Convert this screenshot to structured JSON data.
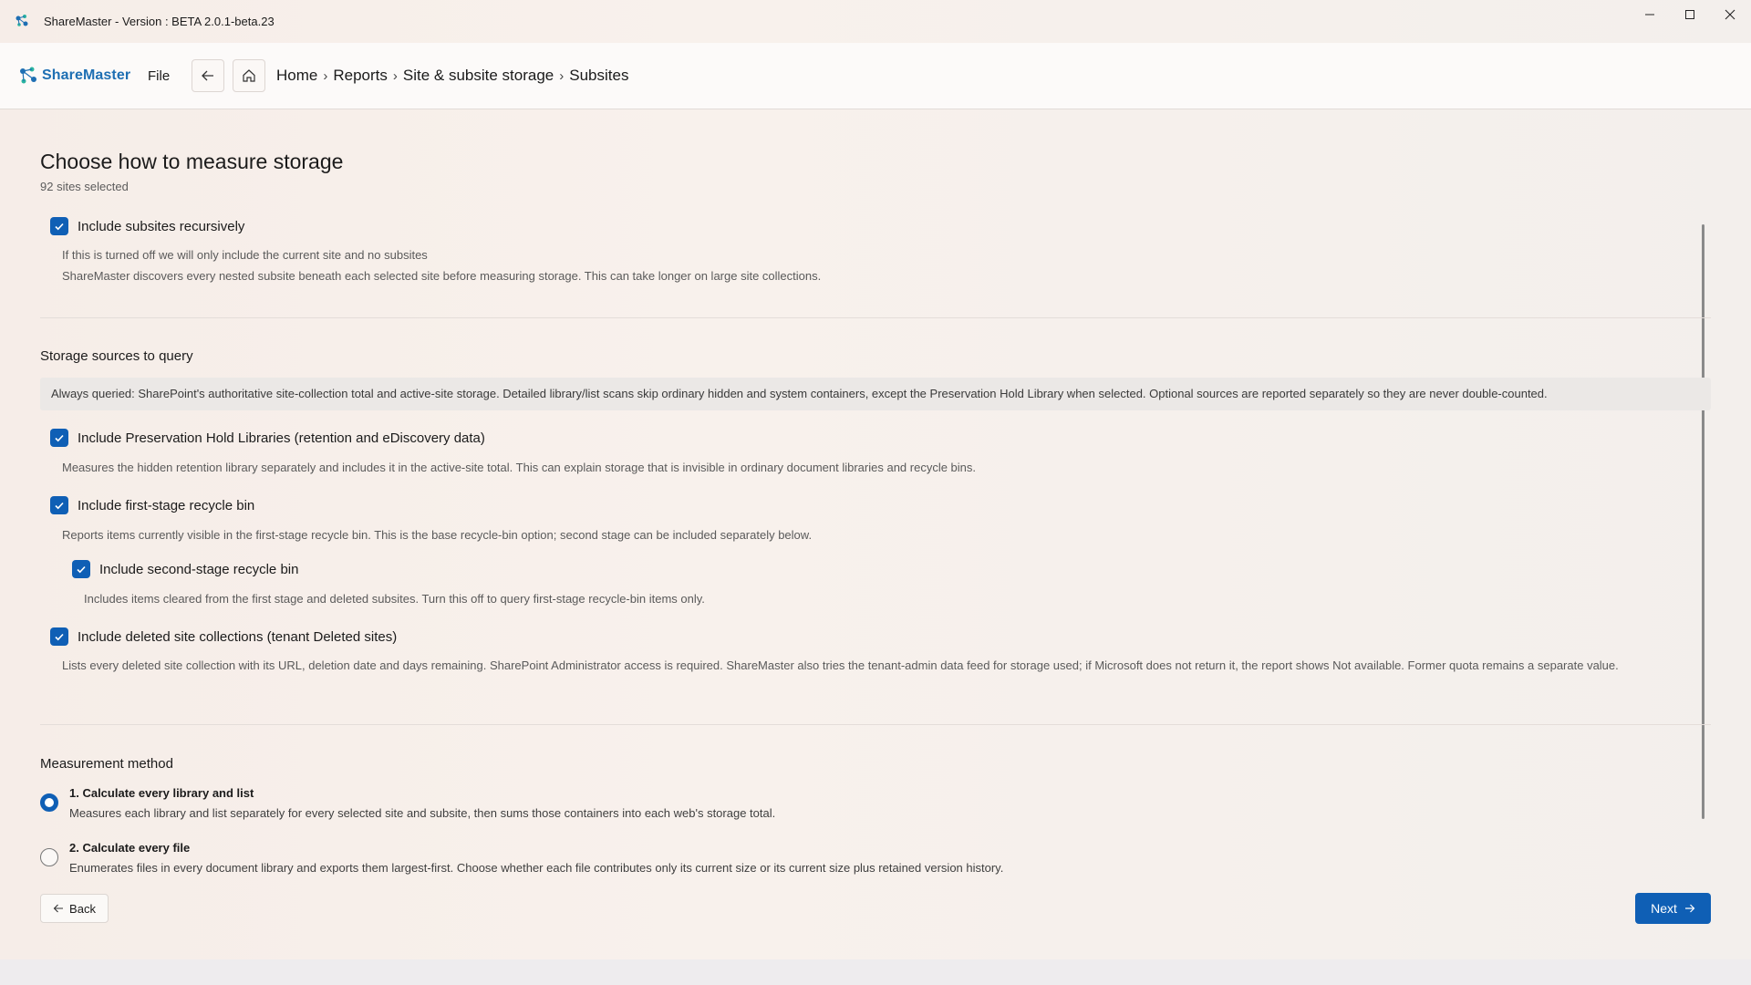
{
  "window": {
    "title": "ShareMaster - Version : BETA 2.0.1-beta.23"
  },
  "header": {
    "logo_text": "ShareMaster",
    "file_label": "File",
    "breadcrumb": [
      "Home",
      "Reports",
      "Site & subsite storage",
      "Subsites"
    ],
    "separator": "›"
  },
  "main": {
    "title": "Choose how to measure storage",
    "subtitle": "92 sites selected",
    "recursive": {
      "label": "Include subsites recursively",
      "checked": true,
      "desc_1": "If this is turned off we will only include the current site and no subsites",
      "desc_2": "ShareMaster discovers every nested subsite beneath each selected site before measuring storage. This can take longer on large site collections."
    },
    "sources": {
      "title": "Storage sources to query",
      "info": "Always queried: SharePoint's authoritative site-collection total and active-site storage. Detailed library/list scans skip ordinary hidden and system containers, except the Preservation Hold Library when selected. Optional sources are reported separately so they are never double-counted.",
      "preservation": {
        "label": "Include Preservation Hold Libraries (retention and eDiscovery data)",
        "checked": true,
        "desc": "Measures the hidden retention library separately and includes it in the active-site total. This can explain storage that is invisible in ordinary document libraries and recycle bins."
      },
      "first_stage": {
        "label": "Include first-stage recycle bin",
        "checked": true,
        "desc": "Reports items currently visible in the first-stage recycle bin. This is the base recycle-bin option; second stage can be included separately below."
      },
      "second_stage": {
        "label": "Include second-stage recycle bin",
        "checked": true,
        "desc": "Includes items cleared from the first stage and deleted subsites. Turn this off to query first-stage recycle-bin items only."
      },
      "deleted_sites": {
        "label": "Include deleted site collections (tenant Deleted sites)",
        "checked": true,
        "desc": "Lists every deleted site collection with its URL, deletion date and days remaining. SharePoint Administrator access is required. ShareMaster also tries the tenant-admin data feed for storage used; if Microsoft does not return it, the report shows Not available. Former quota remains a separate value."
      }
    },
    "method": {
      "title": "Measurement method",
      "options": [
        {
          "title": "1. Calculate every library and list",
          "desc": "Measures each library and list separately for every selected site and subsite, then sums those containers into each web's storage total.",
          "selected": true
        },
        {
          "title": "2. Calculate every file",
          "desc": "Enumerates files in every document library and exports them largest-first. Choose whether each file contributes only its current size or its current size plus retained version history.",
          "selected": false
        }
      ]
    }
  },
  "footer": {
    "back_label": "Back",
    "next_label": "Next"
  },
  "colors": {
    "accent": "#0f5fb5",
    "brand": "#1e6fb3"
  }
}
